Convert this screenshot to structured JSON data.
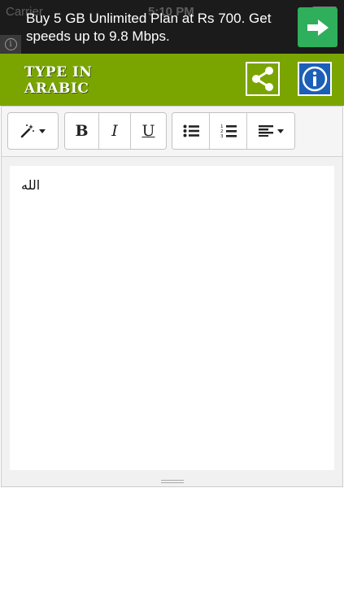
{
  "status_bar": {
    "carrier": "Carrier",
    "time": "5:10 PM"
  },
  "ad": {
    "text": "Buy 5 GB Unlimited Plan at Rs 700. Get speeds up to 9.8 Mbps.",
    "info_icon": "info-icon",
    "cta_icon": "arrow-right-icon",
    "cta_color": "#2fae5b"
  },
  "header": {
    "title": "TYPE IN ARABIC",
    "background_color": "#7aa500",
    "share_icon": "share-icon",
    "info_icon": "info-icon",
    "info_color": "#1c5fb7"
  },
  "toolbar": {
    "style_icon": "magic-wand-icon",
    "bold_label": "B",
    "italic_label": "I",
    "underline_label": "U",
    "bullet_list_icon": "bullet-list-icon",
    "numbered_list_icon": "numbered-list-icon",
    "align_icon": "align-left-icon"
  },
  "editor": {
    "content": "الله"
  }
}
